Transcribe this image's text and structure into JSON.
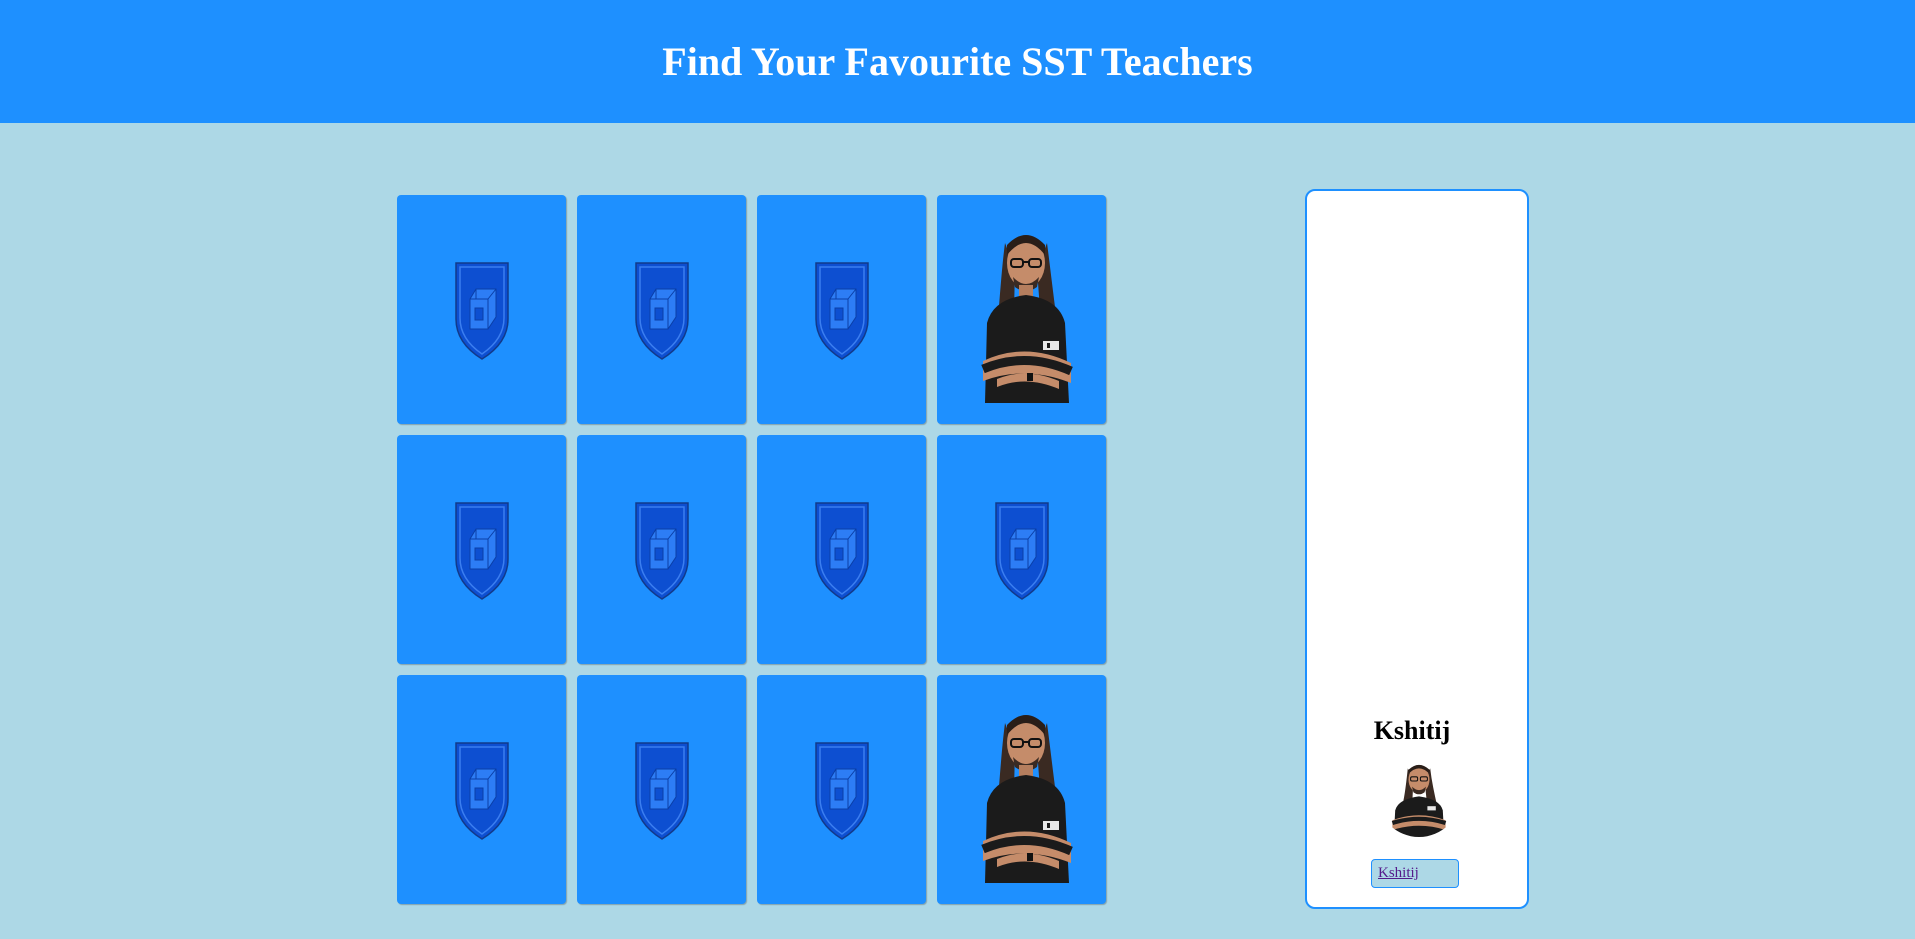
{
  "header": {
    "title": "Find Your Favourite SST Teachers"
  },
  "colors": {
    "header_bg": "#1E90FF",
    "page_bg": "#ADD8E6",
    "card_bg": "#1E90FF",
    "shield_fill": "#0D4FD1",
    "panel_border": "#1E90FF"
  },
  "cards": [
    {
      "face": "shield-icon"
    },
    {
      "face": "shield-icon"
    },
    {
      "face": "shield-icon"
    },
    {
      "face": "teacher-photo"
    },
    {
      "face": "shield-icon"
    },
    {
      "face": "shield-icon"
    },
    {
      "face": "shield-icon"
    },
    {
      "face": "shield-icon"
    },
    {
      "face": "shield-icon"
    },
    {
      "face": "shield-icon"
    },
    {
      "face": "shield-icon"
    },
    {
      "face": "teacher-photo"
    }
  ],
  "panel": {
    "name": "Kshitij",
    "link_label": "Kshitij"
  }
}
